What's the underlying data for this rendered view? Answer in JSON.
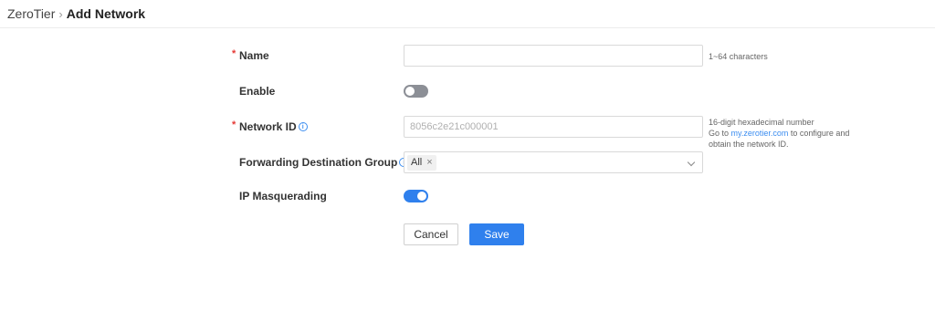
{
  "breadcrumb": {
    "root": "ZeroTier",
    "current": "Add Network"
  },
  "form": {
    "name": {
      "label": "Name",
      "value": "",
      "placeholder": "",
      "hint": "1~64 characters",
      "required": true
    },
    "enable": {
      "label": "Enable",
      "state": "off"
    },
    "network_id": {
      "label": "Network ID",
      "placeholder": "8056c2e21c000001",
      "required": true,
      "hint_line1": "16-digit hexadecimal number",
      "hint_go": "Go to ",
      "hint_link": "my.zerotier.com",
      "hint_after": " to configure and",
      "hint_line3": "obtain the network ID."
    },
    "forwarding_group": {
      "label": "Forwarding Destination Group",
      "selected_tag": "All"
    },
    "ip_masquerading": {
      "label": "IP Masquerading",
      "state": "on"
    }
  },
  "buttons": {
    "cancel": "Cancel",
    "save": "Save"
  },
  "icons": {
    "info": "info-icon",
    "tag_close": "close-icon",
    "dropdown": "chevron-down-icon",
    "breadcrumb_sep": "chevron-right-icon"
  },
  "colors": {
    "accent": "#2f80ed",
    "required": "#e53935",
    "toggle_off": "#8c8f96"
  }
}
